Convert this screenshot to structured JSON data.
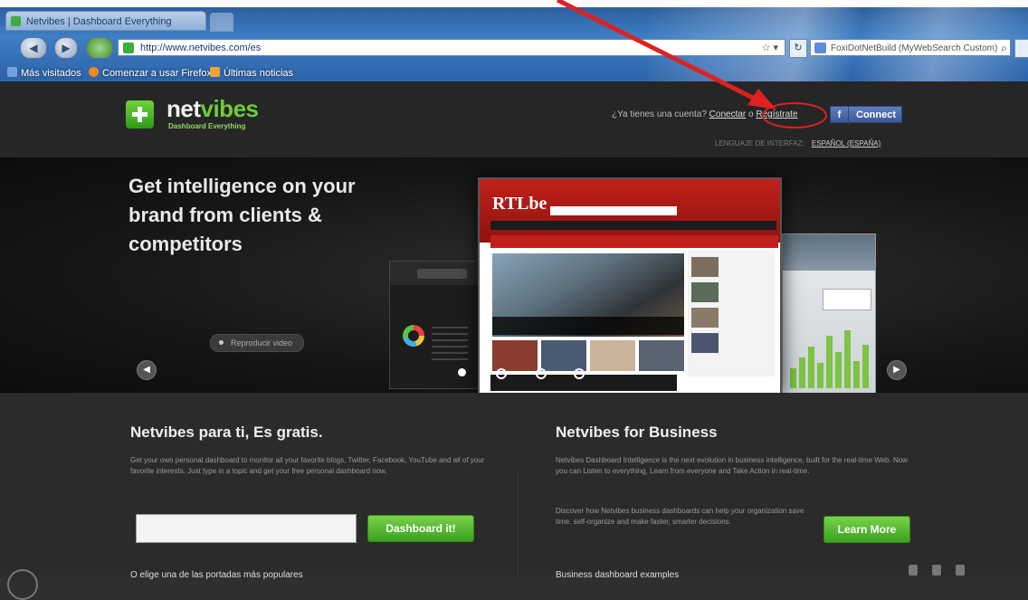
{
  "browser": {
    "tab_title": "Netvibes | Dashboard Everything",
    "url": "http://www.netvibes.com/es",
    "search_placeholder": "FoxiDotNetBuild (MyWebSearch Custom)",
    "bookmarks": [
      "Más visitados",
      "Comenzar a usar Firefox",
      "Últimas noticias"
    ]
  },
  "header": {
    "logo_net": "net",
    "logo_vibes": "vibes",
    "logo_tagline": "Dashboard Everything",
    "account_question": "¿Ya tienes una cuenta?",
    "connect_link": "Conectar",
    "separator": "o",
    "register_link": "Regístrate",
    "fb_connect": "Connect",
    "language_label": "LENGUAJE DE INTERFAZ:",
    "language_value": "ESPAÑOL (ESPAÑA)"
  },
  "hero": {
    "headline": "Get intelligence on your brand from clients & competitors",
    "play_video": "Reproducir video",
    "screen_logo": "RTLbe"
  },
  "personal": {
    "title": "Netvibes para ti, Es gratis.",
    "description": "Get your own personal dashboard to monitor all your favorite blogs, Twitter, Facebook, YouTube and all of your favorite interests. Just type in a topic and get your free personal dashboard now.",
    "button": "Dashboard it!",
    "subheading": "O elige una de las portadas más populares"
  },
  "business": {
    "title": "Netvibes for Business",
    "description": "Netvibes Dashboard Intelligence is the next evolution in business intelligence, built for the real-time Web. Now you can Listen to everything, Learn from everyone and Take Action in real-time.",
    "description2": "Discover how Netvibes business dashboards can help your organization save time, self-organize and make faster, smarter decisions.",
    "button": "Learn More",
    "subheading": "Business dashboard examples"
  },
  "colors": {
    "brand_green": "#6ecb3c",
    "annotation_red": "#e02020",
    "facebook_blue": "#3b5998"
  }
}
